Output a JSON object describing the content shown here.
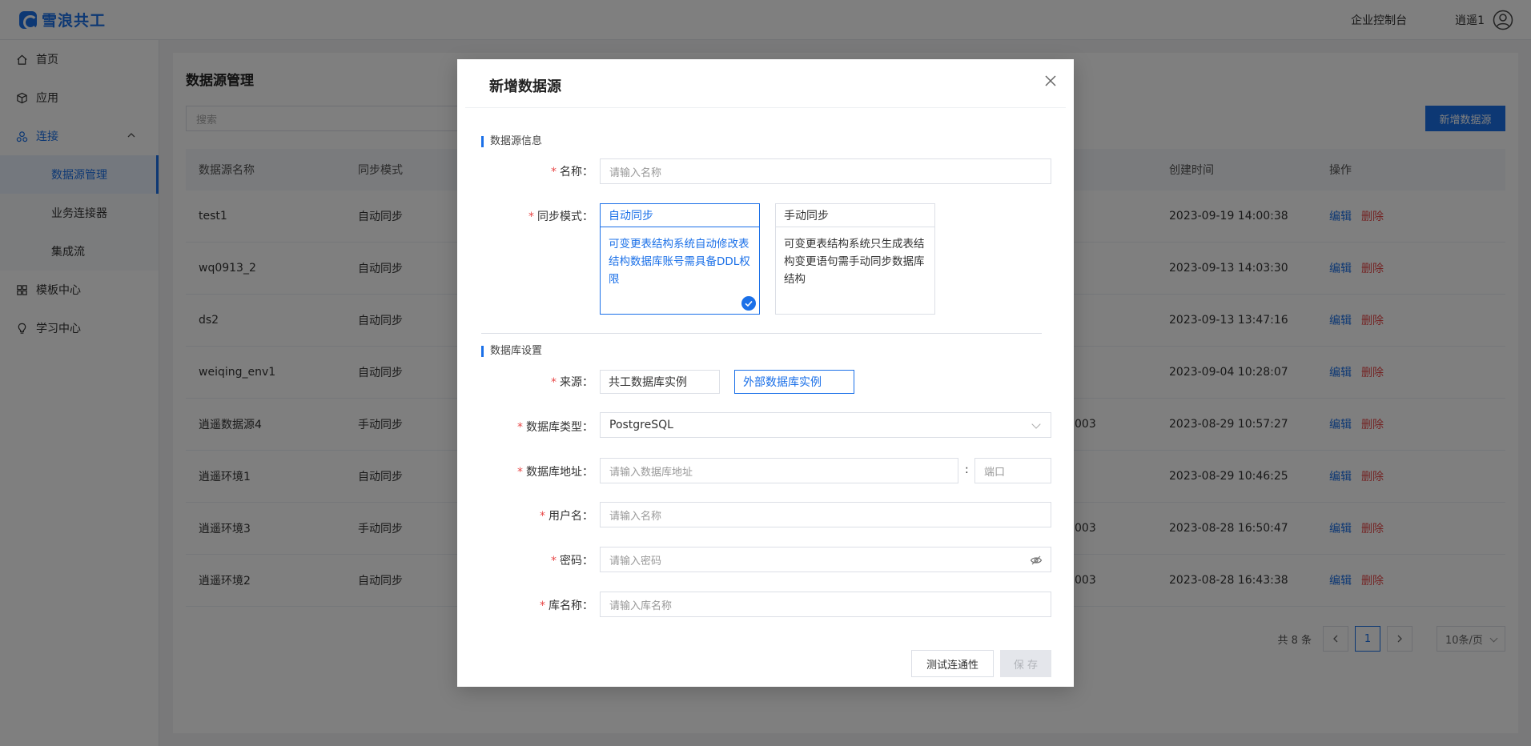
{
  "header": {
    "logo_text": "雪浪共工",
    "console_link": "企业控制台",
    "user_name": "逍遥1"
  },
  "sidebar": {
    "items": [
      {
        "label": "首页"
      },
      {
        "label": "应用"
      },
      {
        "label": "连接"
      },
      {
        "label": "模板中心"
      },
      {
        "label": "学习中心"
      }
    ],
    "sub_items": [
      {
        "label": "数据源管理"
      },
      {
        "label": "业务连接器"
      },
      {
        "label": "集成流"
      }
    ]
  },
  "main": {
    "title": "数据源管理",
    "search_placeholder": "搜索",
    "add_button": "新增数据源",
    "table": {
      "headers": [
        "数据源名称",
        "同步模式",
        "创建时间",
        "操作"
      ],
      "rows": [
        {
          "name": "test1",
          "mode": "自动同步",
          "extra": "",
          "time": "2023-09-19 14:00:38"
        },
        {
          "name": "wq0913_2",
          "mode": "自动同步",
          "extra": "",
          "time": "2023-09-13 14:03:30"
        },
        {
          "name": "ds2",
          "mode": "自动同步",
          "extra": "",
          "time": "2023-09-13 13:47:16"
        },
        {
          "name": "weiqing_env1",
          "mode": "自动同步",
          "extra": "",
          "time": "2023-09-04 10:28:07"
        },
        {
          "name": "逍遥数据源4",
          "mode": "手动同步",
          "extra": "003",
          "time": "2023-08-29 10:57:27"
        },
        {
          "name": "逍遥环境1",
          "mode": "自动同步",
          "extra": "",
          "time": "2023-08-29 10:46:25"
        },
        {
          "name": "逍遥环境3",
          "mode": "手动同步",
          "extra": "003",
          "time": "2023-08-28 16:50:47"
        },
        {
          "name": "逍遥环境2",
          "mode": "自动同步",
          "extra": "003",
          "time": "2023-08-28 16:43:38"
        }
      ],
      "edit_label": "编辑",
      "delete_label": "删除"
    },
    "pagination": {
      "total": "共 8 条",
      "current_page": "1",
      "page_size": "10条/页"
    }
  },
  "modal": {
    "title": "新增数据源",
    "section_info": "数据源信息",
    "section_db": "数据库设置",
    "fields": {
      "name_label": "名称",
      "name_placeholder": "请输入名称",
      "sync_label": "同步模式",
      "source_label": "来源",
      "db_type_label": "数据库类型",
      "db_type_value": "PostgreSQL",
      "db_addr_label": "数据库地址",
      "db_addr_placeholder": "请输入数据库地址",
      "port_placeholder": "端口",
      "username_label": "用户名",
      "username_placeholder": "请输入名称",
      "password_label": "密码",
      "password_placeholder": "请输入密码",
      "dbname_label": "库名称",
      "dbname_placeholder": "请输入库名称"
    },
    "sync_options": [
      {
        "title": "自动同步",
        "desc": "可变更表结构系统自动修改表结构数据库账号需具备DDL权限",
        "selected": true
      },
      {
        "title": "手动同步",
        "desc": "可变更表结构系统只生成表结构变更语句需手动同步数据库结构",
        "selected": false
      }
    ],
    "source_options": [
      {
        "label": "共工数据库实例",
        "selected": false
      },
      {
        "label": "外部数据库实例",
        "selected": true
      }
    ],
    "test_button": "测试连通性",
    "save_button": "保 存"
  },
  "colors": {
    "primary": "#1b70e8",
    "danger": "#e84848"
  }
}
